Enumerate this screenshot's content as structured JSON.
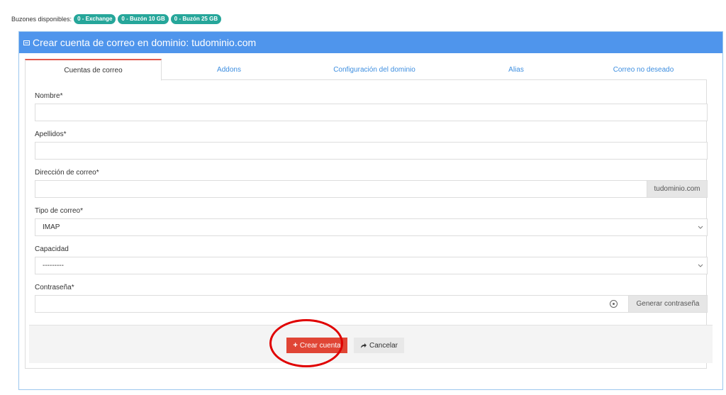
{
  "mailboxes": {
    "label": "Buzones disponibles:",
    "badges": [
      "0 - Exchange",
      "0 - Buzón 10 GB",
      "0 - Buzón 25 GB"
    ]
  },
  "panel": {
    "title": "Crear cuenta de correo en dominio: tudominio.com"
  },
  "tabs": [
    {
      "label": "Cuentas de correo",
      "active": true
    },
    {
      "label": "Addons"
    },
    {
      "label": "Configuración del dominio"
    },
    {
      "label": "Alias"
    },
    {
      "label": "Correo no deseado"
    }
  ],
  "form": {
    "nombre_label": "Nombre*",
    "nombre_value": "",
    "apellidos_label": "Apellidos*",
    "apellidos_value": "",
    "email_label": "Dirección de correo*",
    "email_value": "",
    "email_domain": "tudominio.com",
    "tipo_label": "Tipo de correo*",
    "tipo_value": "IMAP",
    "capacidad_label": "Capacidad",
    "capacidad_value": "---------",
    "password_label": "Contraseña*",
    "password_value": "",
    "generate_password_label": "Generar contraseña"
  },
  "actions": {
    "create_label": "Crear cuenta",
    "cancel_label": "Cancelar"
  },
  "colors": {
    "heading": "#4f95ec",
    "badge": "#26a69a",
    "create_button": "#e04535",
    "highlight": "#e00000"
  }
}
